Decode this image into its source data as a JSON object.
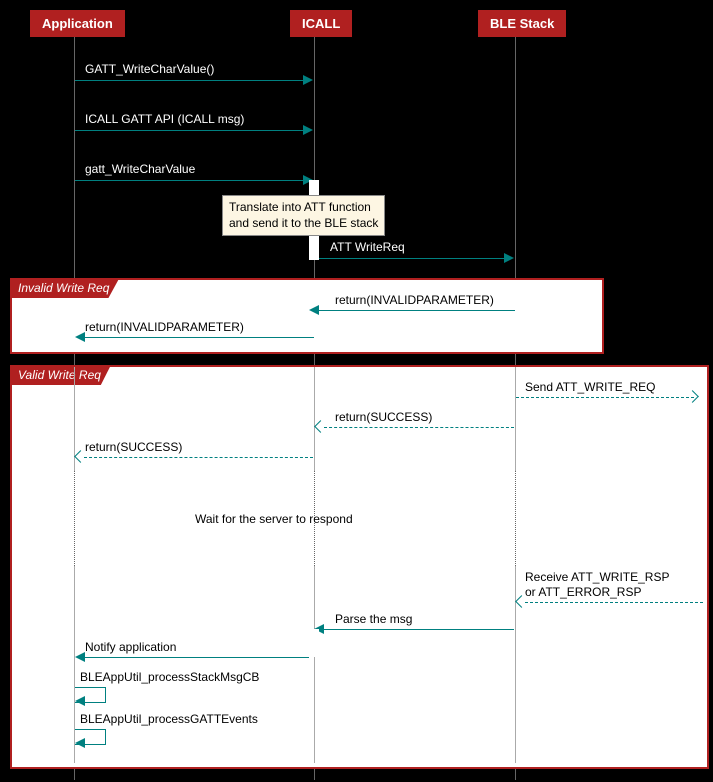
{
  "participants": {
    "app": "Application",
    "icall": "ICALL",
    "ble": "BLE Stack"
  },
  "messages": {
    "m1": "GATT_WriteCharValue()",
    "m2": "ICALL GATT API (ICALL msg)",
    "m3": "gatt_WriteCharValue",
    "note1_l1": "Translate into ATT function",
    "note1_l2": "and send it to the BLE stack",
    "m4": "ATT WriteReq",
    "m5": "return(INVALIDPARAMETER)",
    "m6": "return(INVALIDPARAMETER)",
    "m7": "Send ATT_WRITE_REQ",
    "m8": "return(SUCCESS)",
    "m9": "return(SUCCESS)",
    "wait": "Wait for the server to respond",
    "m10_l1": "Receive ATT_WRITE_RSP",
    "m10_l2": "or ATT_ERROR_RSP",
    "m11": "Parse the msg",
    "m12": "Notify application",
    "m13": "BLEAppUtil_processStackMsgCB",
    "m14": "BLEAppUtil_processGATTEvents"
  },
  "groups": {
    "invalid": "Invalid Write Req",
    "valid": "Valid Write Req"
  }
}
